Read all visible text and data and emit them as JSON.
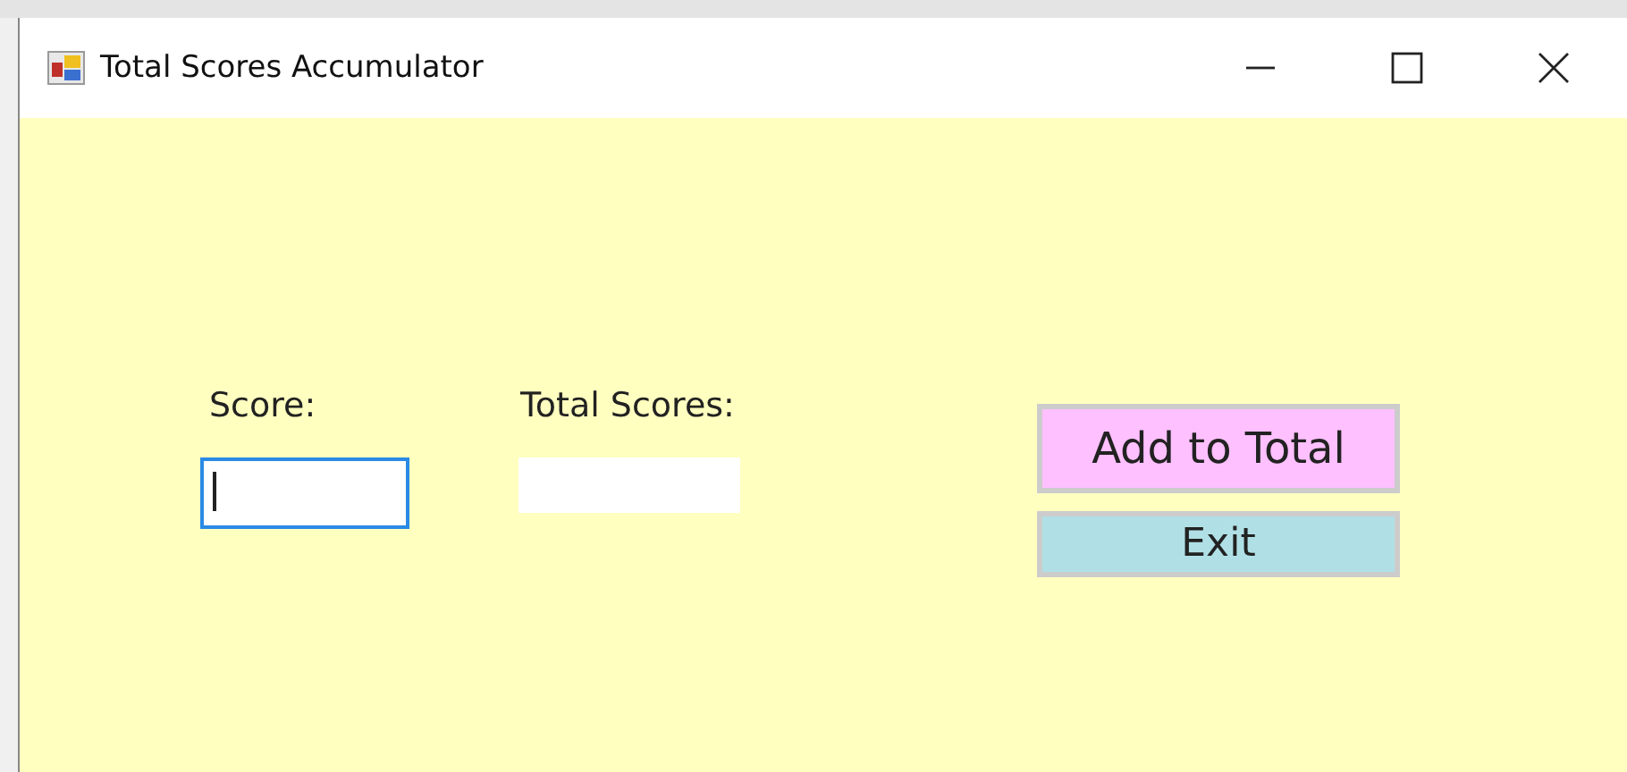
{
  "window": {
    "title": "Total Scores Accumulator"
  },
  "score": {
    "label": "Score:",
    "focused": true
  },
  "total": {
    "label": "Total Scores:"
  },
  "buttons": [
    {
      "label": "Add to Total",
      "color": "#ffc0ff"
    },
    {
      "label": "Exit",
      "color": "#b0e0e6"
    }
  ]
}
